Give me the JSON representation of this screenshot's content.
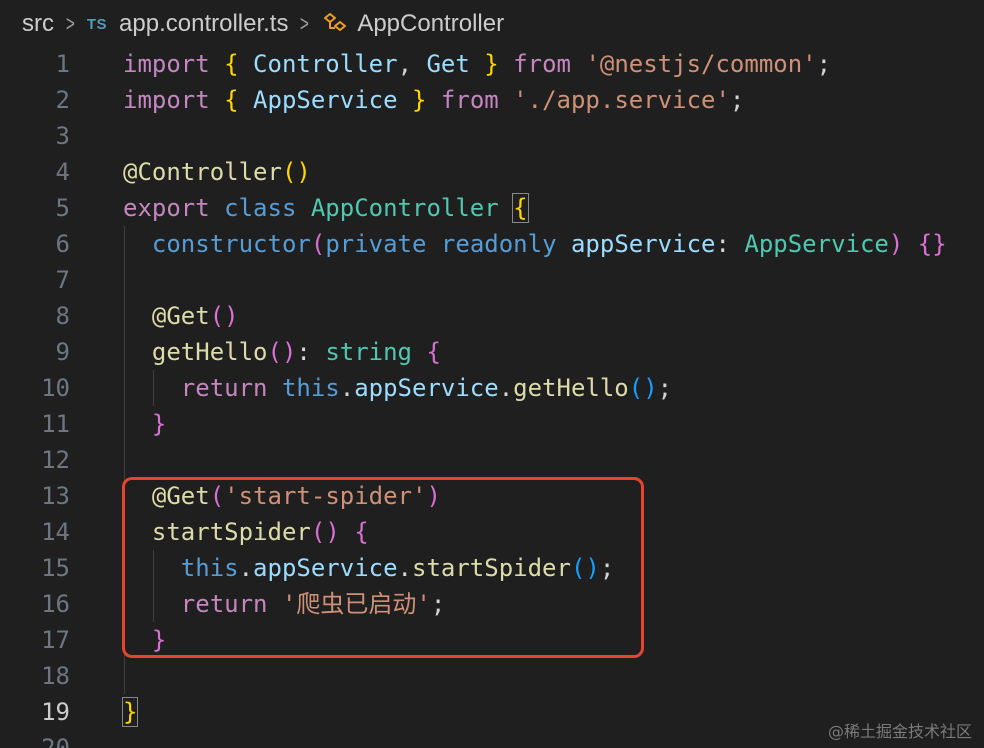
{
  "breadcrumb": {
    "folder": "src",
    "file_icon": "TS",
    "file": "app.controller.ts",
    "symbol": "AppController",
    "separator": ">"
  },
  "editor": {
    "lines": [
      {
        "num": "1",
        "tokens": [
          [
            "import",
            "kw-purple"
          ],
          [
            " ",
            "punct"
          ],
          [
            "{",
            "brace-gold"
          ],
          [
            " Controller",
            "ident"
          ],
          [
            ", ",
            "punct"
          ],
          [
            "Get",
            "ident"
          ],
          [
            " ",
            "punct"
          ],
          [
            "}",
            "brace-gold"
          ],
          [
            " ",
            "punct"
          ],
          [
            "from",
            "kw-purple"
          ],
          [
            " ",
            "punct"
          ],
          [
            "'@nestjs/common'",
            "str"
          ],
          [
            ";",
            "punct"
          ]
        ]
      },
      {
        "num": "2",
        "tokens": [
          [
            "import",
            "kw-purple"
          ],
          [
            " ",
            "punct"
          ],
          [
            "{",
            "brace-gold"
          ],
          [
            " AppService",
            "ident"
          ],
          [
            " ",
            "punct"
          ],
          [
            "}",
            "brace-gold"
          ],
          [
            " ",
            "punct"
          ],
          [
            "from",
            "kw-purple"
          ],
          [
            " ",
            "punct"
          ],
          [
            "'./app.service'",
            "str"
          ],
          [
            ";",
            "punct"
          ]
        ]
      },
      {
        "num": "3",
        "tokens": []
      },
      {
        "num": "4",
        "tokens": [
          [
            "@",
            "deco"
          ],
          [
            "Controller",
            "fn"
          ],
          [
            "(",
            "brace-gold"
          ],
          [
            ")",
            "brace-gold"
          ]
        ]
      },
      {
        "num": "5",
        "tokens": [
          [
            "export",
            "kw-purple"
          ],
          [
            " ",
            "punct"
          ],
          [
            "class",
            "kw-blue"
          ],
          [
            " ",
            "punct"
          ],
          [
            "AppController",
            "type"
          ],
          [
            " ",
            "punct"
          ],
          [
            "{",
            "brace-gold brace-match"
          ]
        ]
      },
      {
        "num": "6",
        "tokens": [
          [
            "  ",
            "punct"
          ],
          [
            "constructor",
            "kw-blue"
          ],
          [
            "(",
            "brace-pink"
          ],
          [
            "private",
            "kw-blue"
          ],
          [
            " ",
            "punct"
          ],
          [
            "readonly",
            "kw-blue"
          ],
          [
            " ",
            "punct"
          ],
          [
            "appService",
            "ident"
          ],
          [
            ": ",
            "punct"
          ],
          [
            "AppService",
            "type"
          ],
          [
            ")",
            "brace-pink"
          ],
          [
            " ",
            "punct"
          ],
          [
            "{}",
            "brace-pink"
          ]
        ]
      },
      {
        "num": "7",
        "tokens": []
      },
      {
        "num": "8",
        "tokens": [
          [
            "  ",
            "punct"
          ],
          [
            "@",
            "deco"
          ],
          [
            "Get",
            "fn"
          ],
          [
            "(",
            "brace-pink"
          ],
          [
            ")",
            "brace-pink"
          ]
        ]
      },
      {
        "num": "9",
        "tokens": [
          [
            "  ",
            "punct"
          ],
          [
            "getHello",
            "fn"
          ],
          [
            "(",
            "brace-pink"
          ],
          [
            ")",
            "brace-pink"
          ],
          [
            ": ",
            "punct"
          ],
          [
            "string",
            "type"
          ],
          [
            " ",
            "punct"
          ],
          [
            "{",
            "brace-pink"
          ]
        ]
      },
      {
        "num": "10",
        "tokens": [
          [
            "    ",
            "punct"
          ],
          [
            "return",
            "kw-purple"
          ],
          [
            " ",
            "punct"
          ],
          [
            "this",
            "kw-blue"
          ],
          [
            ".",
            "punct"
          ],
          [
            "appService",
            "ident"
          ],
          [
            ".",
            "punct"
          ],
          [
            "getHello",
            "fn"
          ],
          [
            "(",
            "brace-blue"
          ],
          [
            ")",
            "brace-blue"
          ],
          [
            ";",
            "punct"
          ]
        ]
      },
      {
        "num": "11",
        "tokens": [
          [
            "  ",
            "punct"
          ],
          [
            "}",
            "brace-pink"
          ]
        ]
      },
      {
        "num": "12",
        "tokens": []
      },
      {
        "num": "13",
        "tokens": [
          [
            "  ",
            "punct"
          ],
          [
            "@",
            "deco"
          ],
          [
            "Get",
            "fn"
          ],
          [
            "(",
            "brace-pink"
          ],
          [
            "'start-spider'",
            "str"
          ],
          [
            ")",
            "brace-pink"
          ]
        ]
      },
      {
        "num": "14",
        "tokens": [
          [
            "  ",
            "punct"
          ],
          [
            "startSpider",
            "fn"
          ],
          [
            "(",
            "brace-pink"
          ],
          [
            ")",
            "brace-pink"
          ],
          [
            " ",
            "punct"
          ],
          [
            "{",
            "brace-pink"
          ]
        ]
      },
      {
        "num": "15",
        "tokens": [
          [
            "    ",
            "punct"
          ],
          [
            "this",
            "kw-blue"
          ],
          [
            ".",
            "punct"
          ],
          [
            "appService",
            "ident"
          ],
          [
            ".",
            "punct"
          ],
          [
            "startSpider",
            "fn"
          ],
          [
            "(",
            "brace-blue"
          ],
          [
            ")",
            "brace-blue"
          ],
          [
            ";",
            "punct"
          ]
        ]
      },
      {
        "num": "16",
        "tokens": [
          [
            "    ",
            "punct"
          ],
          [
            "return",
            "kw-purple"
          ],
          [
            " ",
            "punct"
          ],
          [
            "'爬虫已启动'",
            "str"
          ],
          [
            ";",
            "punct"
          ]
        ]
      },
      {
        "num": "17",
        "tokens": [
          [
            "  ",
            "punct"
          ],
          [
            "}",
            "brace-pink"
          ]
        ]
      },
      {
        "num": "18",
        "tokens": []
      },
      {
        "num": "19",
        "tokens": [
          [
            "}",
            "brace-gold brace-match"
          ]
        ],
        "current": true
      },
      {
        "num": "20",
        "tokens": []
      }
    ]
  },
  "watermark": "@稀土掘金技术社区",
  "colors": {
    "background": "#1f1f1f",
    "highlight_box": "#e8432f"
  }
}
